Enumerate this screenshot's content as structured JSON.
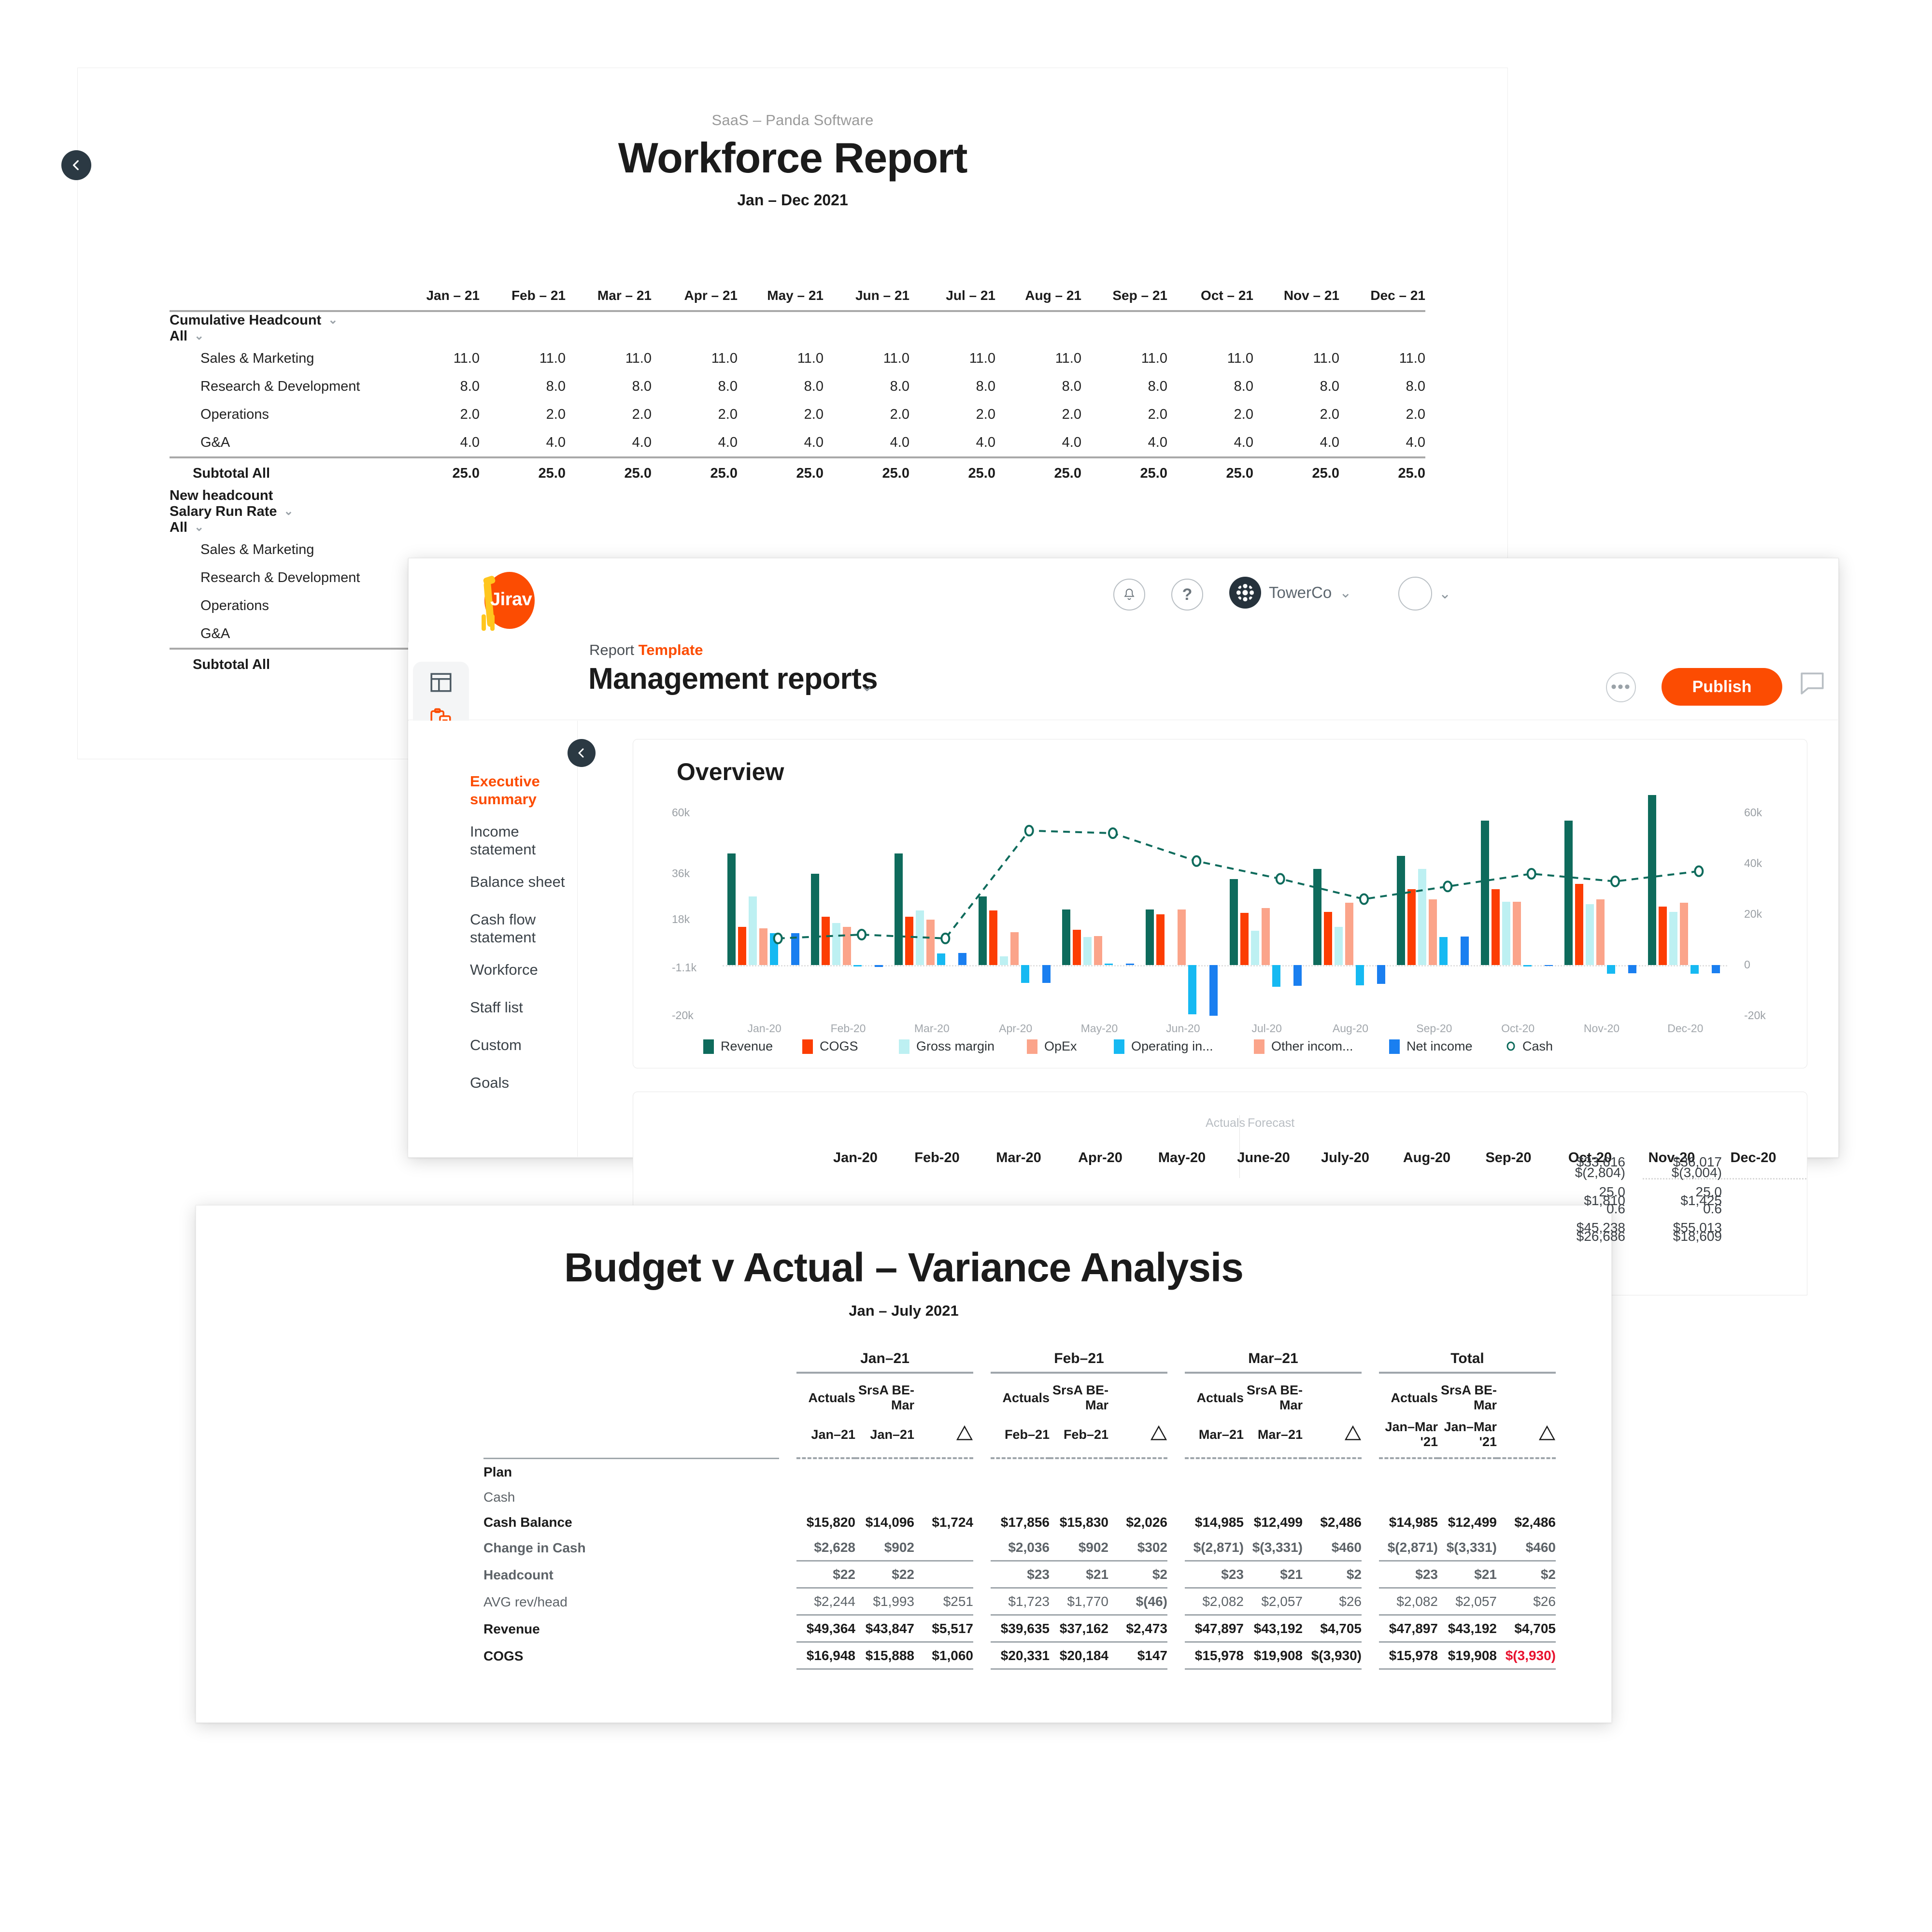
{
  "workforce_report": {
    "back_button": "back",
    "eyebrow": "SaaS – Panda Software",
    "title": "Workforce Report",
    "subtitle": "Jan – Dec 2021",
    "columns": [
      "Jan – 21",
      "Feb – 21",
      "Mar – 21",
      "Apr – 21",
      "May – 21",
      "Jun – 21",
      "Jul – 21",
      "Aug – 21",
      "Sep – 21",
      "Oct – 21",
      "Nov – 21",
      "Dec – 21"
    ],
    "sections": [
      {
        "name": "Cumulative Headcount",
        "group": "All",
        "rows": [
          {
            "label": "Sales & Marketing",
            "values": [
              "11.0",
              "11.0",
              "11.0",
              "11.0",
              "11.0",
              "11.0",
              "11.0",
              "11.0",
              "11.0",
              "11.0",
              "11.0",
              "11.0"
            ]
          },
          {
            "label": "Research & Development",
            "values": [
              "8.0",
              "8.0",
              "8.0",
              "8.0",
              "8.0",
              "8.0",
              "8.0",
              "8.0",
              "8.0",
              "8.0",
              "8.0",
              "8.0"
            ]
          },
          {
            "label": "Operations",
            "values": [
              "2.0",
              "2.0",
              "2.0",
              "2.0",
              "2.0",
              "2.0",
              "2.0",
              "2.0",
              "2.0",
              "2.0",
              "2.0",
              "2.0"
            ]
          },
          {
            "label": "G&A",
            "values": [
              "4.0",
              "4.0",
              "4.0",
              "4.0",
              "4.0",
              "4.0",
              "4.0",
              "4.0",
              "4.0",
              "4.0",
              "4.0",
              "4.0"
            ]
          }
        ],
        "subtotal": {
          "label": "Subtotal All",
          "values": [
            "25.0",
            "25.0",
            "25.0",
            "25.0",
            "25.0",
            "25.0",
            "25.0",
            "25.0",
            "25.0",
            "25.0",
            "25.0",
            "25.0"
          ]
        }
      },
      {
        "name": "New headcount",
        "group": null,
        "rows": [],
        "subtotal": null
      },
      {
        "name": "Salary Run Rate",
        "group": "All",
        "rows": [
          {
            "label": "Sales & Marketing",
            "values": [
              "",
              "",
              "",
              "",
              "",
              "",
              "",
              "",
              "",
              "",
              "",
              ""
            ]
          },
          {
            "label": "Research & Development",
            "values": [
              "",
              "",
              "",
              "",
              "",
              "",
              "",
              "",
              "",
              "",
              "",
              ""
            ]
          },
          {
            "label": "Operations",
            "values": [
              "",
              "",
              "",
              "",
              "",
              "",
              "",
              "",
              "",
              "",
              "",
              ""
            ]
          },
          {
            "label": "G&A",
            "values": [
              "",
              "",
              "",
              "",
              "",
              "",
              "",
              "",
              "",
              "",
              "",
              ""
            ]
          }
        ],
        "subtotal": {
          "label": "Subtotal All",
          "values": [
            "$",
            "",
            "",
            "",
            "",
            "",
            "",
            "",
            "",
            "",
            "",
            ""
          ]
        }
      }
    ]
  },
  "jirav": {
    "logo_text": "Jirav",
    "header": {
      "bell_icon": "bell-icon",
      "help_icon": "question-mark-icon",
      "org_name": "TowerCo",
      "org_chevron": "⌄",
      "avatar_chevron": "⌄"
    },
    "titlebar": {
      "eyebrow_prefix": "Report",
      "eyebrow_highlight": "Template",
      "title": "Management reports",
      "title_chevron": "⌄",
      "more_label": "•••",
      "publish_label": "Publish",
      "comment_icon": "comment-icon"
    },
    "rail_icons": [
      "dashboard-icon",
      "clipboard-report-icon",
      "analytics-icon",
      "gear-icon"
    ],
    "nav": {
      "collapse_button": "collapse",
      "items": [
        {
          "label": "Executive summary",
          "active": true
        },
        {
          "label": "Income statement",
          "active": false
        },
        {
          "label": "Balance sheet",
          "active": false
        },
        {
          "label": "Cash flow statement",
          "active": false
        },
        {
          "label": "Workforce",
          "active": false
        },
        {
          "label": "Staff list",
          "active": false
        },
        {
          "label": "Custom",
          "active": false
        },
        {
          "label": "Goals",
          "active": false
        }
      ]
    },
    "lower_table": {
      "actuals_label": "Actuals",
      "forecast_label": "Forecast",
      "months": [
        "Jan-20",
        "Feb-20",
        "Mar-20",
        "Apr-20",
        "May-20",
        "June-20",
        "July-20",
        "Aug-20",
        "Sep-20",
        "Oct-20",
        "Nov-20",
        "Dec-20"
      ],
      "peek_values": {
        "nov": [
          "$33,616",
          "$(2,804)",
          "25.0",
          "$1,810",
          "0.6",
          "$45,238",
          "$26,686"
        ],
        "dec": [
          "$36,017",
          "$(3,004)",
          "25.0",
          "$1,425",
          "0.6",
          "$55,013",
          "$18,609"
        ]
      }
    }
  },
  "chart_data": {
    "type": "bar",
    "title": "Overview",
    "xlabel": "",
    "ylabel": "",
    "ylim": [
      -20000,
      60000
    ],
    "y_ticks_left": [
      "60k",
      "36k",
      "18k",
      "-1.1k",
      "-20k"
    ],
    "y_ticks_right": [
      "60k",
      "40k",
      "20k",
      "0",
      "-20k"
    ],
    "grid": false,
    "legend_position": "bottom",
    "categories": [
      "Jan-20",
      "Feb-20",
      "Mar-20",
      "Apr-20",
      "May-20",
      "Jun-20",
      "Jul-20",
      "Aug-20",
      "Sep-20",
      "Oct-20",
      "Nov-20",
      "Dec-20"
    ],
    "series": [
      {
        "name": "Revenue",
        "color": "#0e6b5c",
        "type": "bar",
        "values": [
          44000,
          36000,
          44000,
          27000,
          22000,
          22000,
          34000,
          38000,
          43000,
          57000,
          57000,
          67000
        ]
      },
      {
        "name": "COGS",
        "color": "#fc3d03",
        "type": "bar",
        "values": [
          15000,
          19000,
          19000,
          21500,
          14000,
          20000,
          20500,
          21000,
          30000,
          30000,
          32000,
          23000
        ]
      },
      {
        "name": "Gross margin",
        "color": "#bdf0f2",
        "type": "bar",
        "values": [
          27000,
          16500,
          21500,
          3500,
          11000,
          0,
          13500,
          15000,
          38000,
          25000,
          24000,
          21000
        ]
      },
      {
        "name": "OpEx",
        "color": "#fba48a",
        "type": "bar",
        "values": [
          14500,
          15000,
          18000,
          13000,
          11500,
          22000,
          22500,
          24500,
          26000,
          25000,
          26000,
          24500
        ]
      },
      {
        "name": "Operating in...",
        "color": "#16b9f2",
        "type": "bar",
        "values": [
          12500,
          -600,
          4500,
          -7000,
          600,
          -19500,
          -8500,
          -8000,
          11000,
          -500,
          -3500,
          -3500
        ]
      },
      {
        "name": "Other incom...",
        "color": "#fba48a",
        "type": "bar",
        "values": [
          0,
          0,
          0,
          0,
          0,
          0,
          0,
          0,
          0,
          0,
          0,
          0
        ]
      },
      {
        "name": "Net income",
        "color": "#1a7ff0",
        "type": "bar",
        "values": [
          12500,
          -700,
          4700,
          -7000,
          600,
          -20000,
          -8200,
          -7500,
          11200,
          -300,
          -3300,
          -3300
        ]
      },
      {
        "name": "Cash",
        "color": "#0e6b5c",
        "type": "line",
        "values": [
          10500,
          12000,
          10500,
          53000,
          52000,
          41000,
          34000,
          26000,
          31000,
          36000,
          33000,
          37000
        ]
      }
    ]
  },
  "budget_report": {
    "title": "Budget v Actual – Variance Analysis",
    "subtitle": "Jan – July 2021",
    "column_groups": [
      {
        "name": "Jan–21",
        "cols": [
          "Actuals",
          "SrsA BE-Mar",
          "delta"
        ],
        "periods": [
          "Jan–21",
          "Jan–21",
          ""
        ]
      },
      {
        "name": "Feb–21",
        "cols": [
          "Actuals",
          "SrsA BE-Mar",
          "delta"
        ],
        "periods": [
          "Feb–21",
          "Feb–21",
          ""
        ]
      },
      {
        "name": "Mar–21",
        "cols": [
          "Actuals",
          "SrsA BE-Mar",
          "delta"
        ],
        "periods": [
          "Mar–21",
          "Mar–21",
          ""
        ]
      },
      {
        "name": "Total",
        "cols": [
          "Actuals",
          "SrsA BE-Mar",
          "delta"
        ],
        "periods": [
          "Jan–Mar '21",
          "Jan–Mar '21",
          ""
        ]
      }
    ],
    "delta_symbol": "triangle-icon",
    "rows": [
      {
        "label": "Plan",
        "level": 1,
        "bold": true,
        "values": [
          "",
          "",
          "",
          "",
          "",
          "",
          "",
          "",
          "",
          "",
          "",
          ""
        ]
      },
      {
        "label": "Cash",
        "level": 2,
        "dim": true,
        "values": [
          "",
          "",
          "",
          "",
          "",
          "",
          "",
          "",
          "",
          "",
          "",
          ""
        ]
      },
      {
        "label": "Cash Balance",
        "level": 2,
        "bold": true,
        "values": [
          "$15,820",
          "$14,096",
          "$1,724",
          "$17,856",
          "$15,830",
          "$2,026",
          "$14,985",
          "$12,499",
          "$2,486",
          "$14,985",
          "$12,499",
          "$2,486"
        ]
      },
      {
        "label": "Change in Cash",
        "level": 2,
        "bold": true,
        "dim": true,
        "values": [
          "$2,628",
          "$902",
          "",
          "$2,036",
          "$902",
          "$302",
          "$(2,871)",
          "$(3,331)",
          "$460",
          "$(2,871)",
          "$(3,331)",
          "$460"
        ]
      },
      {
        "label": "Headcount",
        "level": 1,
        "bold": true,
        "dim": true,
        "rule_above": true,
        "values": [
          "$22",
          "$22",
          "",
          "$23",
          "$21",
          "$2",
          "$23",
          "$21",
          "$2",
          "$23",
          "$21",
          "$2"
        ]
      },
      {
        "label": "AVG rev/head",
        "level": 3,
        "dim": true,
        "rule_above": true,
        "values": [
          "$2,244",
          "$1,993",
          "$251",
          "$1,723",
          "$1,770",
          "$(46)",
          "$2,082",
          "$2,057",
          "$26",
          "$2,082",
          "$2,057",
          "$26"
        ],
        "negatives": [
          false,
          false,
          false,
          false,
          false,
          true,
          false,
          false,
          false,
          false,
          false,
          false
        ]
      },
      {
        "label": "Revenue",
        "level": 1,
        "bold": true,
        "rule_above": true,
        "values": [
          "$49,364",
          "$43,847",
          "$5,517",
          "$39,635",
          "$37,162",
          "$2,473",
          "$47,897",
          "$43,192",
          "$4,705",
          "$47,897",
          "$43,192",
          "$4,705"
        ]
      },
      {
        "label": "COGS",
        "level": 1,
        "bold": true,
        "rule_above": true,
        "values": [
          "$16,948",
          "$15,888",
          "$1,060",
          "$20,331",
          "$20,184",
          "$147",
          "$15,978",
          "$19,908",
          "$(3,930)",
          "$15,978",
          "$19,908",
          "$(3,930)"
        ],
        "negatives": [
          false,
          false,
          false,
          false,
          false,
          false,
          false,
          false,
          false,
          false,
          false,
          true
        ]
      }
    ]
  },
  "colors": {
    "brand_orange": "#fc4c02",
    "dark": "#2b3943",
    "negative_red": "#e8112d",
    "revenue": "#0e6b5c",
    "cogs": "#fc3d03",
    "gross_margin": "#bdf0f2",
    "opex": "#fba48a",
    "operating_income": "#16b9f2",
    "net_income": "#1a7ff0"
  }
}
